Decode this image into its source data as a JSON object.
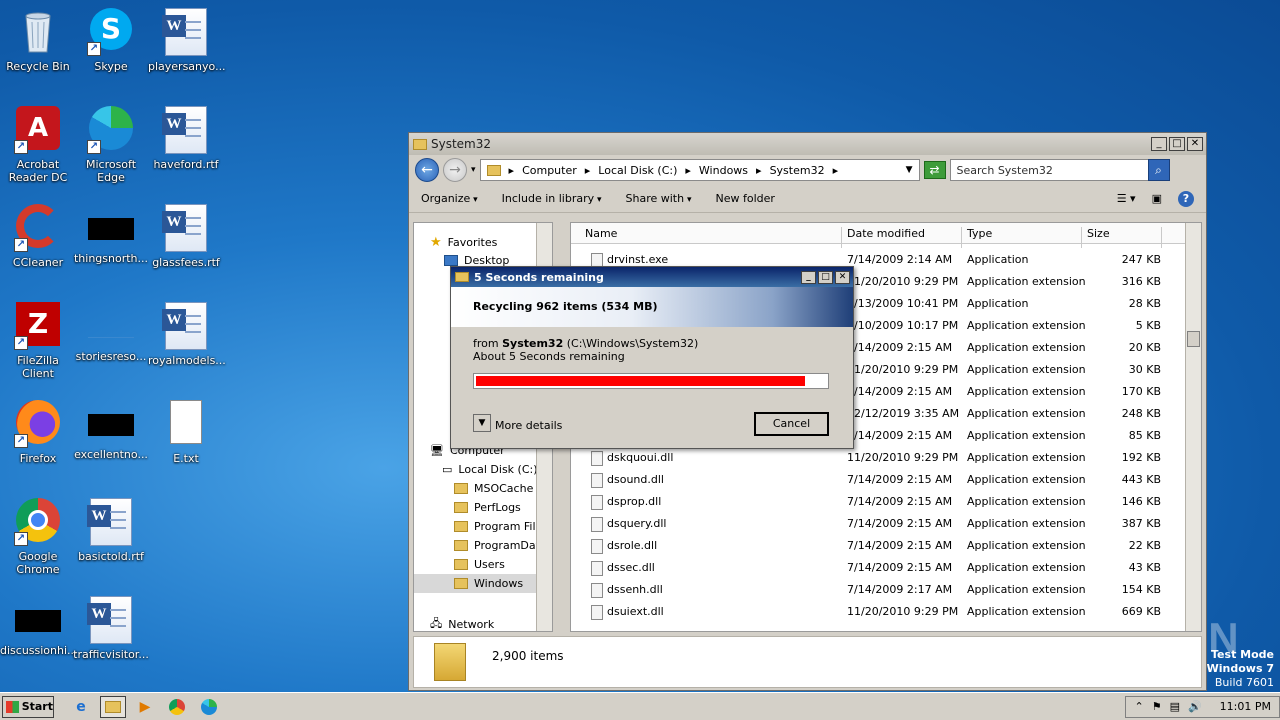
{
  "desktop": {
    "icons": [
      {
        "label": "Recycle Bin"
      },
      {
        "label": "Skype"
      },
      {
        "label": "playersanyo..."
      },
      {
        "label": "Acrobat Reader DC"
      },
      {
        "label": "Microsoft Edge"
      },
      {
        "label": "haveford.rtf"
      },
      {
        "label": "CCleaner"
      },
      {
        "label": "thingsnorth..."
      },
      {
        "label": "glassfees.rtf"
      },
      {
        "label": "FileZilla Client"
      },
      {
        "label": "storiesreso..."
      },
      {
        "label": "royalmodels..."
      },
      {
        "label": "Firefox"
      },
      {
        "label": "excellentno..."
      },
      {
        "label": "E.txt"
      },
      {
        "label": "Google Chrome"
      },
      {
        "label": "basictold.rtf"
      },
      {
        "label": "discussionhi..."
      },
      {
        "label": "trafficvisitor..."
      }
    ]
  },
  "explorer": {
    "title": "System32",
    "breadcrumb": [
      "Computer",
      "Local Disk (C:)",
      "Windows",
      "System32"
    ],
    "search_placeholder": "Search System32",
    "toolbar": {
      "organize": "Organize",
      "include": "Include in library",
      "share": "Share with",
      "new_folder": "New folder"
    },
    "nav": {
      "favorites": "Favorites",
      "desktop": "Desktop",
      "computer": "Computer",
      "local_disk": "Local Disk (C:)",
      "folders": [
        "MSOCache",
        "PerfLogs",
        "Program Files",
        "ProgramData",
        "Users",
        "Windows"
      ],
      "network": "Network"
    },
    "columns": {
      "name": "Name",
      "date": "Date modified",
      "type": "Type",
      "size": "Size"
    },
    "files": [
      {
        "name": "drvinst.exe",
        "date": "7/14/2009 2:14 AM",
        "type": "Application",
        "size": "247 KB"
      },
      {
        "name": "",
        "date": "11/20/2010 9:29 PM",
        "type": "Application extension",
        "size": "316 KB"
      },
      {
        "name": "",
        "date": "7/13/2009 10:41 PM",
        "type": "Application",
        "size": "28 KB"
      },
      {
        "name": "",
        "date": "6/10/2009 10:17 PM",
        "type": "Application extension",
        "size": "5 KB"
      },
      {
        "name": "",
        "date": "7/14/2009 2:15 AM",
        "type": "Application extension",
        "size": "20 KB"
      },
      {
        "name": "",
        "date": "11/20/2010 9:29 PM",
        "type": "Application extension",
        "size": "30 KB"
      },
      {
        "name": "",
        "date": "7/14/2009 2:15 AM",
        "type": "Application extension",
        "size": "170 KB"
      },
      {
        "name": "",
        "date": "12/12/2019 3:35 AM",
        "type": "Application extension",
        "size": "248 KB"
      },
      {
        "name": "",
        "date": "7/14/2009 2:15 AM",
        "type": "Application extension",
        "size": "85 KB"
      },
      {
        "name": "dskquoui.dll",
        "date": "11/20/2010 9:29 PM",
        "type": "Application extension",
        "size": "192 KB"
      },
      {
        "name": "dsound.dll",
        "date": "7/14/2009 2:15 AM",
        "type": "Application extension",
        "size": "443 KB"
      },
      {
        "name": "dsprop.dll",
        "date": "7/14/2009 2:15 AM",
        "type": "Application extension",
        "size": "146 KB"
      },
      {
        "name": "dsquery.dll",
        "date": "7/14/2009 2:15 AM",
        "type": "Application extension",
        "size": "387 KB"
      },
      {
        "name": "dsrole.dll",
        "date": "7/14/2009 2:15 AM",
        "type": "Application extension",
        "size": "22 KB"
      },
      {
        "name": "dssec.dll",
        "date": "7/14/2009 2:15 AM",
        "type": "Application extension",
        "size": "43 KB"
      },
      {
        "name": "dssenh.dll",
        "date": "7/14/2009 2:17 AM",
        "type": "Application extension",
        "size": "154 KB"
      },
      {
        "name": "dsuiext.dll",
        "date": "11/20/2010 9:29 PM",
        "type": "Application extension",
        "size": "669 KB"
      }
    ],
    "status_count": "2,900 items"
  },
  "dialog": {
    "title": "5 Seconds remaining",
    "heading": "Recycling 962 items (534 MB)",
    "from_prefix": "from",
    "from_name": "System32",
    "from_path": "(C:\\Windows\\System32)",
    "remaining": "About 5 Seconds remaining",
    "progress": 0.94,
    "more_details": "More details",
    "cancel": "Cancel",
    "accent": "#ff0000"
  },
  "taskbar": {
    "start": "Start",
    "clock": "11:01 PM"
  },
  "watermark": {
    "brand": "ANY RUN",
    "test_mode": "Test Mode",
    "os": "Windows 7",
    "build": "Build 7601"
  }
}
